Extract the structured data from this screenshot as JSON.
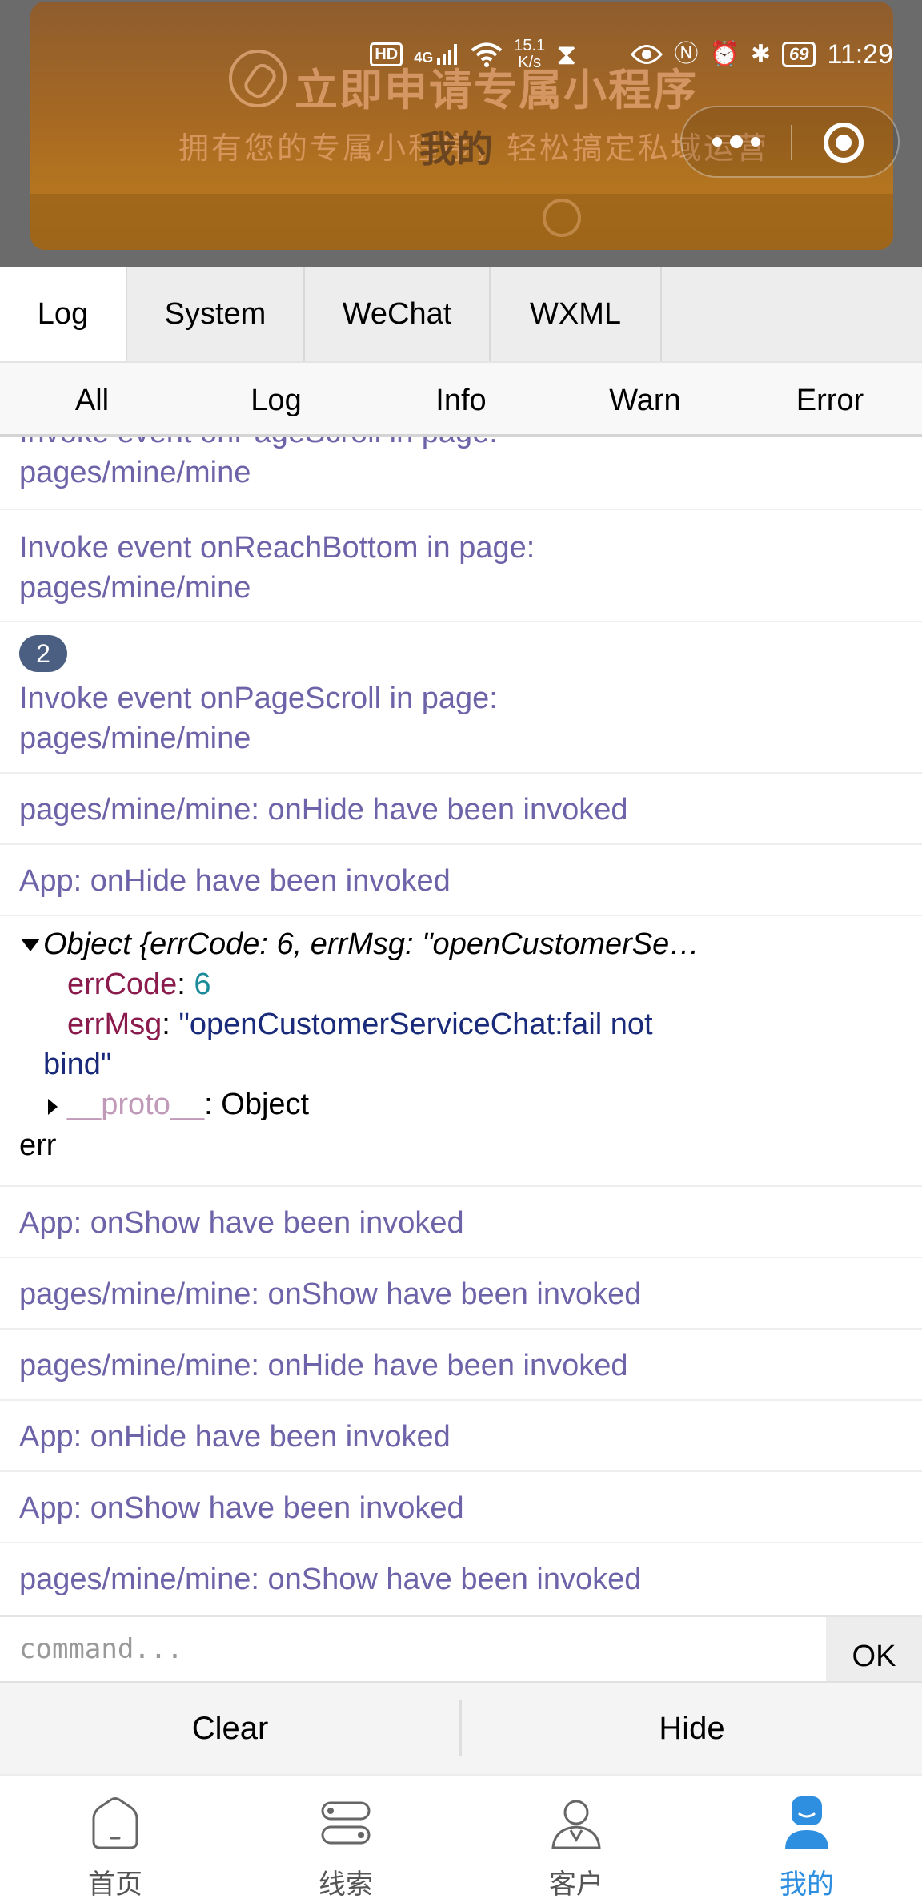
{
  "status_bar": {
    "hd": "HD",
    "network": "4G",
    "speed_value": "15.1",
    "speed_unit": "K/s",
    "battery": "69",
    "time": "11:29"
  },
  "banner": {
    "title": "立即申请专属小程序",
    "subtitle": "拥有您的专属小程序，轻松搞定私域运营",
    "page_title": "我的"
  },
  "panel": {
    "tabs": [
      {
        "label": "Log",
        "active": true
      },
      {
        "label": "System",
        "active": false
      },
      {
        "label": "WeChat",
        "active": false
      },
      {
        "label": "WXML",
        "active": false
      }
    ],
    "filters": [
      "All",
      "Log",
      "Info",
      "Warn",
      "Error"
    ]
  },
  "logs": [
    {
      "line1": "Invoke event onPageScroll in page:",
      "line2": "pages/mine/mine"
    },
    {
      "line1": "Invoke event onReachBottom in page:",
      "line2": "pages/mine/mine"
    },
    {
      "badge": "2",
      "line1": "Invoke event onPageScroll in page:",
      "line2": "pages/mine/mine"
    },
    {
      "line1": "pages/mine/mine: onHide have been invoked"
    },
    {
      "line1": "App: onHide have been invoked"
    },
    {
      "object": {
        "summary": "Object {errCode: 6, errMsg: \"openCustomerSe…",
        "errcode_key": "errCode",
        "errcode_value": "6",
        "errmsg_key": "errMsg",
        "errmsg_value_line1": "\"openCustomerServiceChat:fail not",
        "errmsg_value_line2": "bind\"",
        "proto_key": "__proto__",
        "proto_value": "Object"
      },
      "suffix": "err"
    },
    {
      "line1": "App: onShow have been invoked"
    },
    {
      "line1": "pages/mine/mine: onShow have been invoked"
    },
    {
      "line1": "pages/mine/mine: onHide have been invoked"
    },
    {
      "line1": "App: onHide have been invoked"
    },
    {
      "line1": "App: onShow have been invoked"
    },
    {
      "line1": "pages/mine/mine: onShow have been invoked"
    }
  ],
  "command": {
    "placeholder": "command...",
    "ok_label": "OK"
  },
  "actions": {
    "clear_label": "Clear",
    "hide_label": "Hide"
  },
  "bottom_nav": [
    {
      "label": "首页",
      "icon": "home-icon",
      "active": false
    },
    {
      "label": "线索",
      "icon": "clues-icon",
      "active": false
    },
    {
      "label": "客户",
      "icon": "customer-icon",
      "active": false
    },
    {
      "label": "我的",
      "icon": "profile-icon",
      "active": true
    }
  ],
  "colors": {
    "log_text": "#6c63a8",
    "accent_blue": "#2e8fe0",
    "badge_bg": "#4a5f82"
  }
}
